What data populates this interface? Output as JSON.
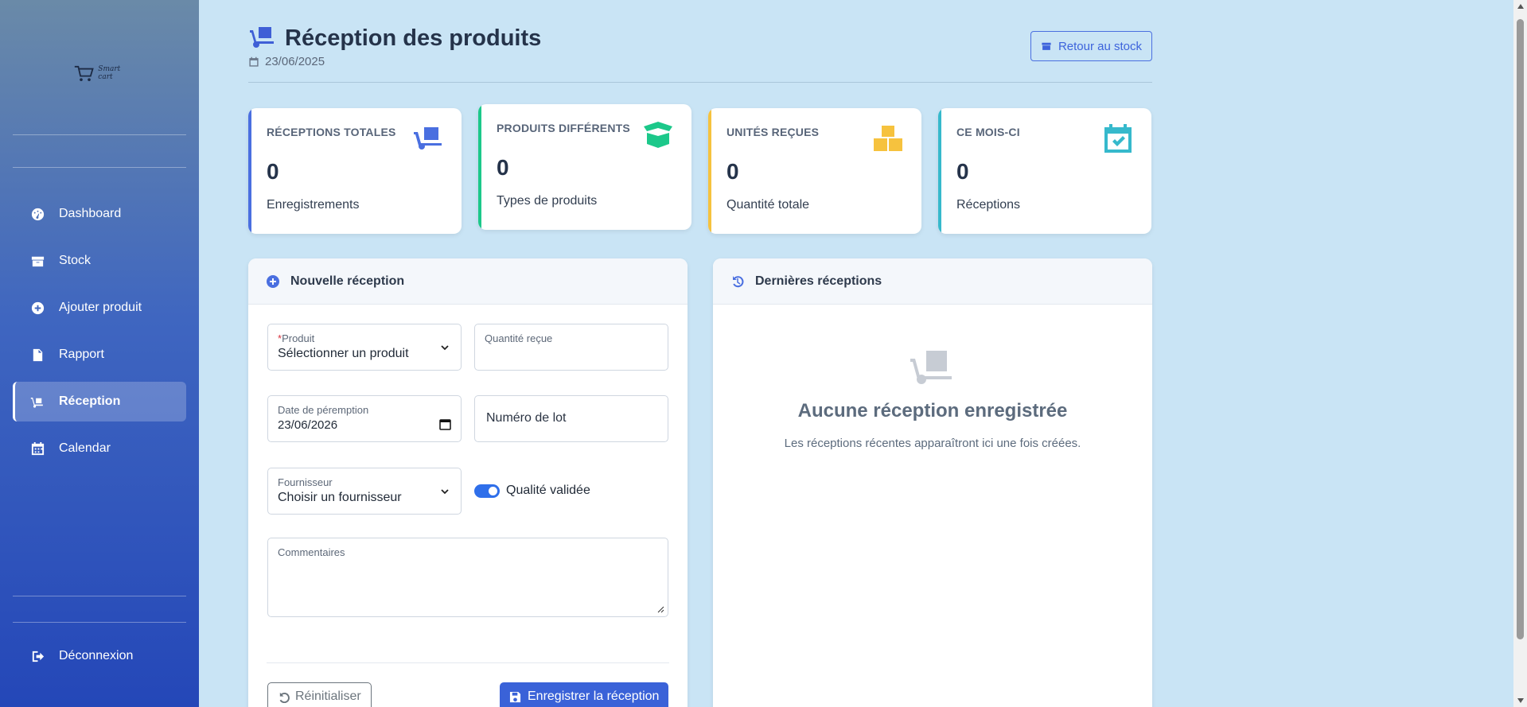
{
  "sidebar": {
    "logo_text": "Smart cart",
    "items": [
      {
        "label": "Dashboard",
        "icon": "gauge-icon"
      },
      {
        "label": "Stock",
        "icon": "box-icon"
      },
      {
        "label": "Ajouter produit",
        "icon": "plus-circle-icon"
      },
      {
        "label": "Rapport",
        "icon": "file-icon"
      },
      {
        "label": "Réception",
        "icon": "dolly-icon",
        "active": true
      },
      {
        "label": "Calendar",
        "icon": "calendar-icon"
      }
    ],
    "logout": "Déconnexion"
  },
  "header": {
    "title": "Réception des produits",
    "date": "23/06/2025",
    "back_button": "Retour au stock"
  },
  "stats": [
    {
      "label": "Réceptions totales",
      "value": "0",
      "sub": "Enregistrements",
      "icon": "dolly-icon",
      "color": "#4a6fe0"
    },
    {
      "label": "Produits différents",
      "value": "0",
      "sub": "Types de produits",
      "icon": "box-open-icon",
      "color": "#1cc88a"
    },
    {
      "label": "Unités reçues",
      "value": "0",
      "sub": "Quantité totale",
      "icon": "boxes-icon",
      "color": "#f6c23e"
    },
    {
      "label": "Ce mois-ci",
      "value": "0",
      "sub": "Réceptions",
      "icon": "calendar-check-icon",
      "color": "#36b9cc"
    }
  ],
  "form": {
    "title": "Nouvelle réception",
    "product": {
      "required_mark": "*",
      "label": "Produit",
      "value": "Sélectionner un produit"
    },
    "quantity": {
      "label": "Quantité reçue",
      "value": ""
    },
    "expiry": {
      "label": "Date de péremption",
      "value": "23/06/2026"
    },
    "lot": {
      "placeholder": "Numéro de lot"
    },
    "supplier": {
      "label": "Fournisseur",
      "value": "Choisir un fournisseur"
    },
    "quality": {
      "label": "Qualité validée",
      "checked": true
    },
    "comments": {
      "label": "Commentaires",
      "value": ""
    },
    "reset_button": "Réinitialiser",
    "save_button": "Enregistrer la réception"
  },
  "recent": {
    "title": "Dernières réceptions",
    "empty_title": "Aucune réception enregistrée",
    "empty_sub": "Les réceptions récentes apparaîtront ici une fois créées."
  }
}
